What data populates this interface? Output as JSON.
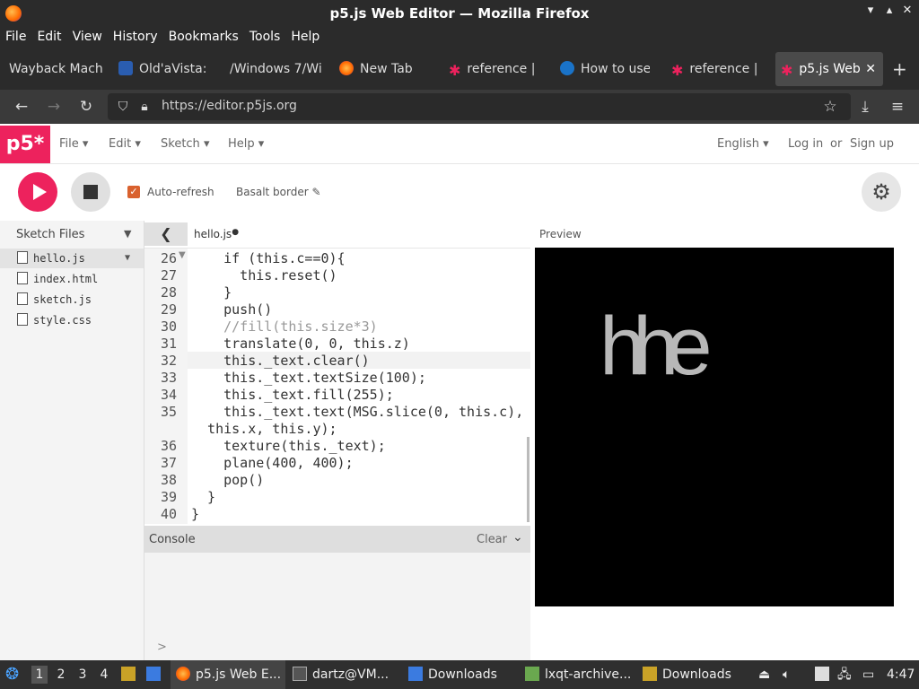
{
  "window": {
    "title": "p5.js Web Editor — Mozilla Firefox"
  },
  "menubar": [
    "File",
    "Edit",
    "View",
    "History",
    "Bookmarks",
    "Tools",
    "Help"
  ],
  "tabs": [
    {
      "label": "Wayback Mach"
    },
    {
      "label": "Old'aVista:"
    },
    {
      "label": "/Windows 7/Wi"
    },
    {
      "label": "New Tab"
    },
    {
      "label": "reference |"
    },
    {
      "label": "How to use"
    },
    {
      "label": "reference |"
    },
    {
      "label": "p5.js Web"
    }
  ],
  "address": {
    "url": "https://editor.p5js.org"
  },
  "p5header": {
    "logo": "p5*",
    "menus": [
      "File",
      "Edit",
      "Sketch",
      "Help"
    ],
    "language": "English",
    "login": "Log in",
    "or": "or",
    "signup": "Sign up"
  },
  "toolbar": {
    "autorefresh_label": "Auto-refresh",
    "sketch_name": "Basalt border"
  },
  "sidebar": {
    "header": "Sketch Files",
    "files": [
      "hello.js",
      "index.html",
      "sketch.js",
      "style.css"
    ]
  },
  "editor": {
    "tab_name": "hello.js",
    "line_numbers": [
      "26",
      "27",
      "28",
      "29",
      "30",
      "31",
      "32",
      "33",
      "34",
      "35",
      "",
      "36",
      "37",
      "38",
      "39",
      "40"
    ],
    "lines": [
      "    if (this.c==0){",
      "      this.reset()",
      "    }",
      "    push()",
      "    //fill(this.size*3)",
      "    translate(0, 0, this.z)",
      "    this._text.clear()",
      "    this._text.textSize(100);",
      "    this._text.fill(255);",
      "    this._text.text(MSG.slice(0, this.c),",
      "  this.x, this.y);",
      "    texture(this._text);",
      "    plane(400, 400);",
      "    pop()",
      "  }",
      "}"
    ]
  },
  "console": {
    "label": "Console",
    "clear": "Clear",
    "prompt": ">"
  },
  "preview": {
    "label": "Preview",
    "canvas_text": "hhe"
  },
  "taskbar": {
    "workspaces": [
      "1",
      "2",
      "3",
      "4"
    ],
    "apps": [
      "p5.js Web E...",
      "dartz@VM...",
      "Downloads",
      "lxqt-archive...",
      "Downloads"
    ],
    "clock": "4:47"
  }
}
